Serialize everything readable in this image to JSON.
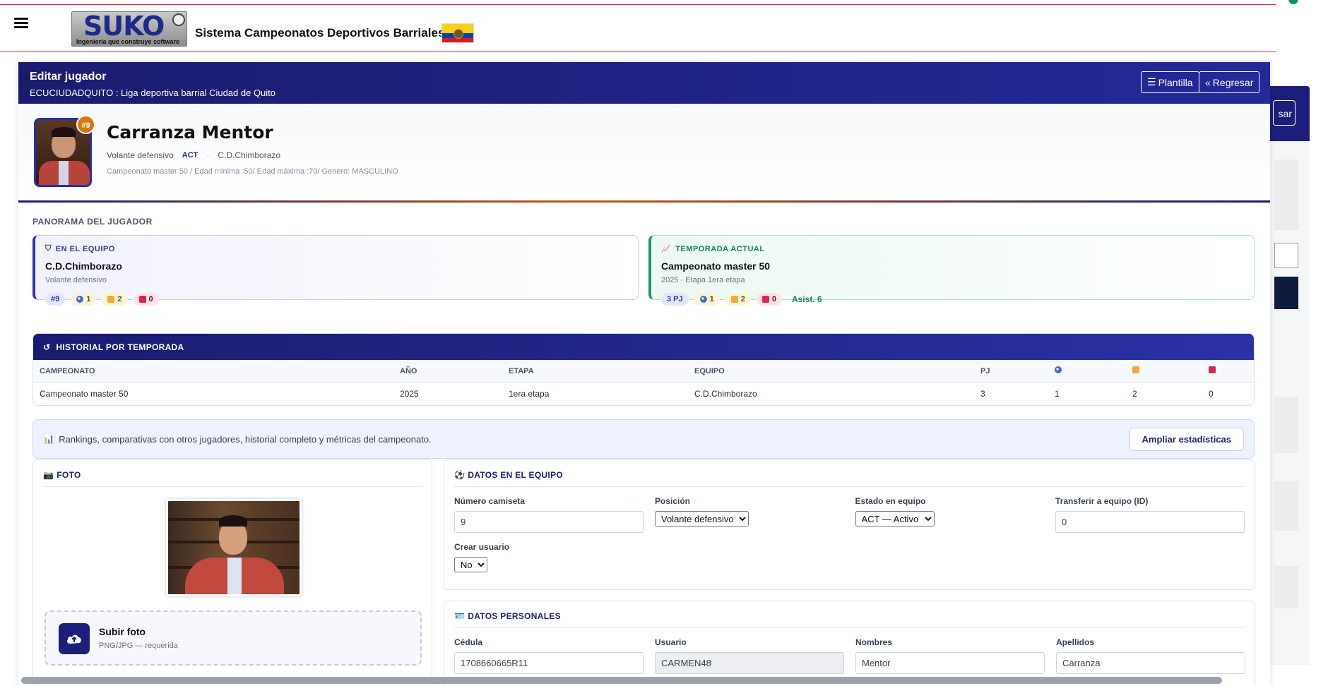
{
  "app": {
    "title": "Sistema Campeonatos Deportivos Barriales",
    "logo_word": "SUKO",
    "logo_tagline": "Ingeniería que construye software"
  },
  "panel": {
    "title": "Editar jugador",
    "subtitle": "ECUCIUDADQUITO : Liga deportiva barrial Ciudad de Quito",
    "btn_plantilla": "Plantilla",
    "btn_regresar": "Regresar"
  },
  "right_strip": {
    "button_fragment": "sar"
  },
  "player": {
    "name": "Carranza Mentor",
    "number_badge": "#9",
    "position": "Volante defensivo",
    "status": "ACT",
    "team": "C.D.Chimborazo",
    "meta": "Campeonato master 50 / Edad minima :50/ Edad máxima :70/ Genero: MASCULINO"
  },
  "overview": {
    "title": "PANORAMA DEL JUGADOR",
    "team_card": {
      "label": "EN EL EQUIPO",
      "name": "C.D.Chimborazo",
      "sub": "Volante defensivo",
      "number": "#9",
      "goals": "1",
      "yellow": "2",
      "red": "0"
    },
    "season_card": {
      "label": "TEMPORADA ACTUAL",
      "name": "Campeonato master 50",
      "sub": "2025 · Etapa 1era etapa",
      "pj": "3 PJ",
      "goals": "1",
      "yellow": "2",
      "red": "0",
      "assists": "Asist. 6"
    }
  },
  "history": {
    "title": "HISTORIAL POR TEMPORADA",
    "columns": [
      "CAMPEONATO",
      "AÑO",
      "ETAPA",
      "EQUIPO",
      "PJ"
    ],
    "rows": [
      {
        "campeonato": "Campeonato master 50",
        "anio": "2025",
        "etapa": "1era etapa",
        "equipo": "C.D.Chimborazo",
        "pj": "3",
        "goles": "1",
        "amarillas": "2",
        "rojas": "0"
      }
    ]
  },
  "banner": {
    "text": "Rankings, comparativas con otros jugadores, historial completo y métricas del campeonato.",
    "button": "Ampliar estadísticas"
  },
  "foto": {
    "title": "FOTO",
    "upload_title": "Subir foto",
    "upload_hint": "PNG/JPG — requerida"
  },
  "equipo": {
    "title": "DATOS EN EL EQUIPO",
    "camiseta_label": "Número camiseta",
    "camiseta_value": "9",
    "posicion_label": "Posición",
    "posicion_value": "Volante defensivo",
    "estado_label": "Estado en equipo",
    "estado_value": "ACT — Activo",
    "transferir_label": "Transferir a equipo (ID)",
    "transferir_value": "0",
    "crear_label": "Crear usuario",
    "crear_value": "No"
  },
  "personal": {
    "title": "DATOS PERSONALES",
    "cedula_label": "Cédula",
    "cedula_value": "1708660665R11",
    "usuario_label": "Usuario",
    "usuario_value": "CARMEN48",
    "nombres_label": "Nombres",
    "nombres_value": "Mentor",
    "apellidos_label": "Apellidos",
    "apellidos_value": "Carranza"
  },
  "colors": {
    "brand_navy": "#191c6e",
    "accent_orange": "#d9770a",
    "success_green": "#1c9b6a",
    "divider_red": "#e11d2a"
  }
}
